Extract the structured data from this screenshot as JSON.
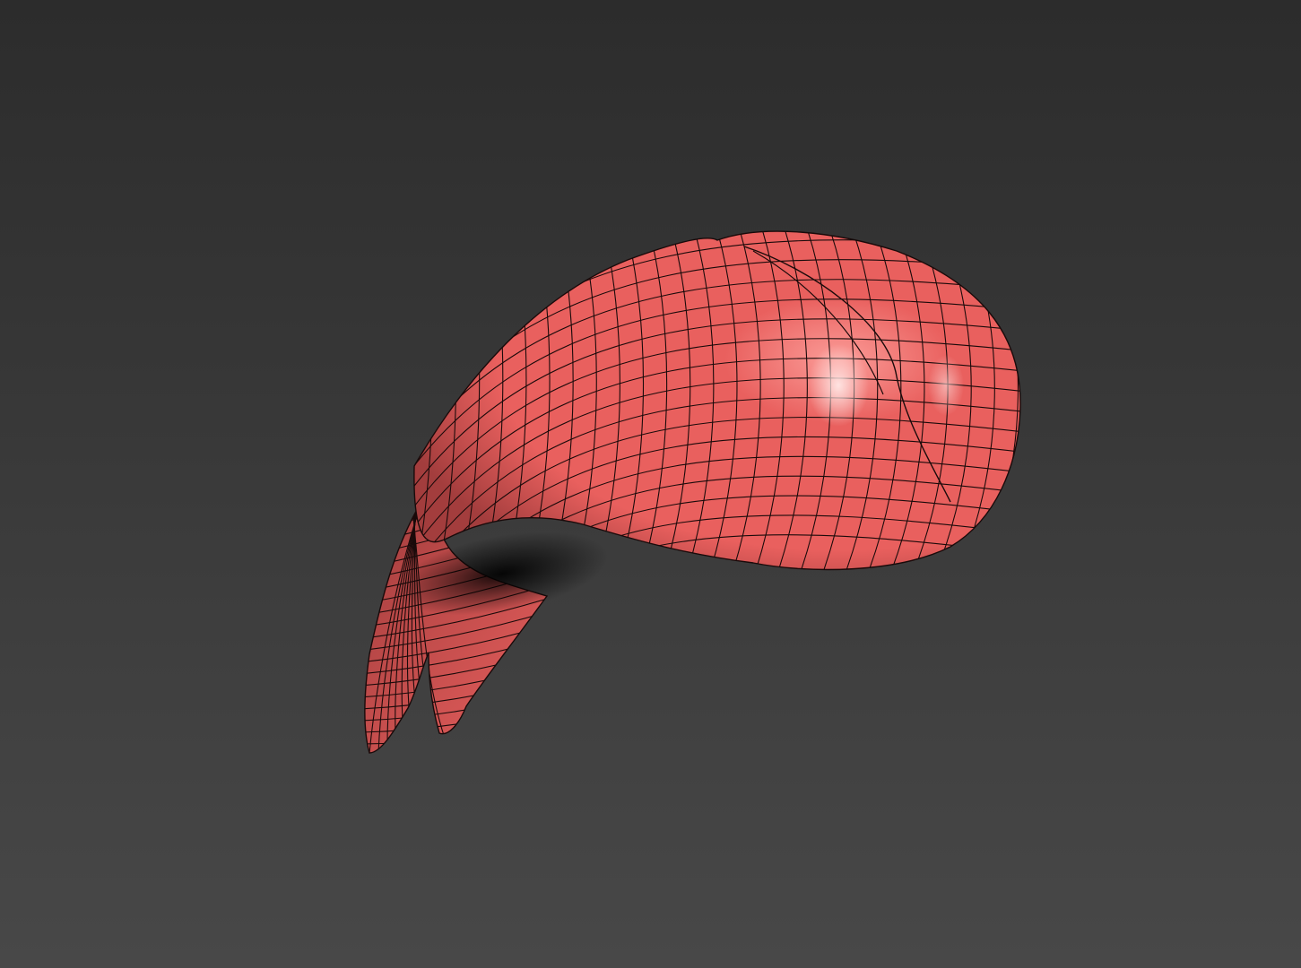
{
  "viewport": {
    "background_top": "#2c2c2c",
    "background_bottom": "#484848"
  },
  "model": {
    "object": "hair-mesh",
    "shading": "wireframe-on-shaded",
    "surface_color": "#e9605e",
    "surface_light": "#fb9c98",
    "surface_dark": "#a33d3d",
    "wire_color": "#1a0a0a"
  }
}
